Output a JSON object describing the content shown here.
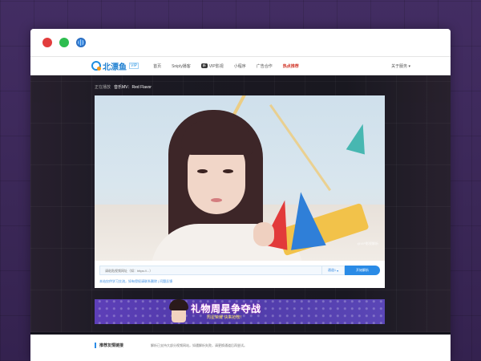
{
  "nav": {
    "logo_text": "北漂鱼",
    "logo_badge": "VIP",
    "items": [
      {
        "label": "首页"
      },
      {
        "label": "Sniply播客"
      },
      {
        "label": "VIP影视"
      },
      {
        "label": "小程序"
      },
      {
        "label": "广告合作"
      },
      {
        "label": "热点推荐"
      }
    ],
    "mini_badge": "新",
    "right_label": "关于服务 ▾"
  },
  "player": {
    "now_playing_prefix": "正在播放",
    "now_playing_title": "音乐MV：Red Flavor",
    "watermark": "@VIP影视解析",
    "search_placeholder": "请粘贴视频网址（如：https://...）",
    "source_label": "通道1",
    "parse_button": "开始解析",
    "notice": "本站仅供学习交流，如有侵权请联系删除 | 问题反馈"
  },
  "banner": {
    "title": "礼物周星争夺战",
    "subtitle": "周星荣耀 快来抢榜！"
  },
  "footer": {
    "heading": "推荐友情链接",
    "description": "解析已支持大部分视频网站，如遇解析失败，请更换通道后再尝试。"
  },
  "colors": {
    "accent": "#2a8be6",
    "brand": "#1e7fd0",
    "hot": "#d23b2e",
    "background": "#3a2756"
  }
}
